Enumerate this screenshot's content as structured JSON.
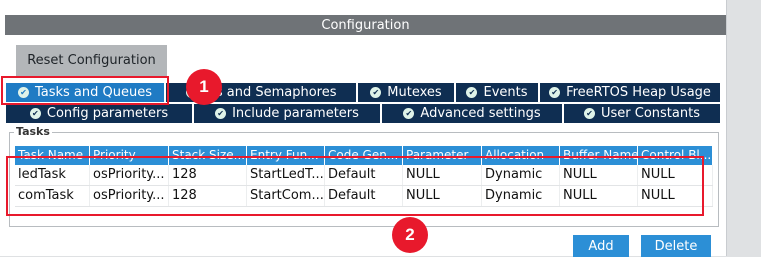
{
  "header": {
    "title": "Configuration"
  },
  "reset_label": "Reset Configuration",
  "tabs_row1": [
    {
      "label": "Tasks and Queues",
      "active": true
    },
    {
      "label": "ers and Semaphores"
    },
    {
      "label": "Mutexes"
    },
    {
      "label": "Events"
    },
    {
      "label": "FreeRTOS Heap Usage"
    }
  ],
  "tabs_row2": [
    {
      "label": "Config parameters"
    },
    {
      "label": "Include parameters"
    },
    {
      "label": "Advanced settings"
    },
    {
      "label": "User Constants"
    }
  ],
  "tasks": {
    "legend": "Tasks",
    "columns": [
      "Task Name",
      "Priority",
      "Stack Size...",
      "Entry Fun...",
      "Code Gen...",
      "Parameter",
      "Allocation",
      "Buffer Name",
      "Control Bl..."
    ],
    "rows": [
      [
        "ledTask",
        "osPriority...",
        "128",
        "StartLedT...",
        "Default",
        "NULL",
        "Dynamic",
        "NULL",
        "NULL"
      ],
      [
        "comTask",
        "osPriority...",
        "128",
        "StartCom...",
        "Default",
        "NULL",
        "Dynamic",
        "NULL",
        "NULL"
      ]
    ]
  },
  "badges": {
    "one": "1",
    "two": "2"
  },
  "buttons": {
    "add": "Add",
    "delete": "Delete"
  },
  "colors": {
    "tab_bg": "#0f2e52",
    "tab_active": "#1f7bc4",
    "grid_header": "#2c8fd6",
    "highlight": "#e8192c"
  }
}
